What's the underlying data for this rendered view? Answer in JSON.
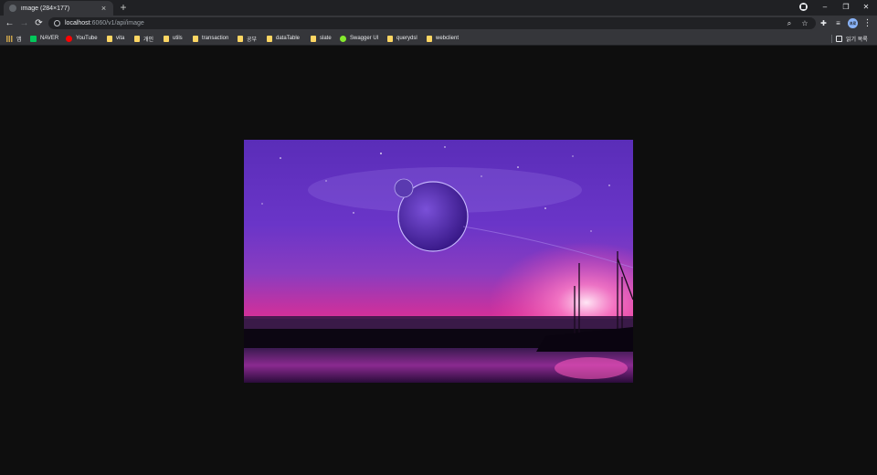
{
  "tab": {
    "title": "image (284×177)",
    "close_glyph": "×",
    "favicon": "globe-icon"
  },
  "new_tab_glyph": "+",
  "window_controls": {
    "minimize": "–",
    "restore": "❐",
    "close": "✕"
  },
  "toolbar": {
    "back": "←",
    "forward": "→",
    "reload": "⟳",
    "url_host": "localhost",
    "url_rest": ":6060/v1/api/image",
    "zoom_glyph": "⌕",
    "star_glyph": "☆",
    "extensions_glyph": "✚",
    "media_glyph": "≡",
    "menu_glyph": "⋮",
    "avatar_text": "프로"
  },
  "bookmarks": {
    "apps_label": "앱",
    "items": [
      {
        "label": "NAVER",
        "icon": "naver-icon"
      },
      {
        "label": "YouTube",
        "icon": "youtube-icon"
      },
      {
        "label": "vita",
        "icon": "folder-icon"
      },
      {
        "label": "개인",
        "icon": "folder-icon"
      },
      {
        "label": "utils",
        "icon": "folder-icon"
      },
      {
        "label": "transaction",
        "icon": "folder-icon"
      },
      {
        "label": "공부",
        "icon": "folder-icon"
      },
      {
        "label": "dataTable",
        "icon": "folder-icon"
      },
      {
        "label": "slate",
        "icon": "folder-icon"
      },
      {
        "label": "Swagger UI",
        "icon": "swagger-icon"
      },
      {
        "label": "querydsl",
        "icon": "folder-icon"
      },
      {
        "label": "webclient",
        "icon": "folder-icon"
      }
    ],
    "reading_list": "읽기 목록"
  },
  "colors": {
    "page_bg": "#0e0e0e",
    "chrome_bg": "#35363a",
    "tabstrip_bg": "#202124"
  }
}
